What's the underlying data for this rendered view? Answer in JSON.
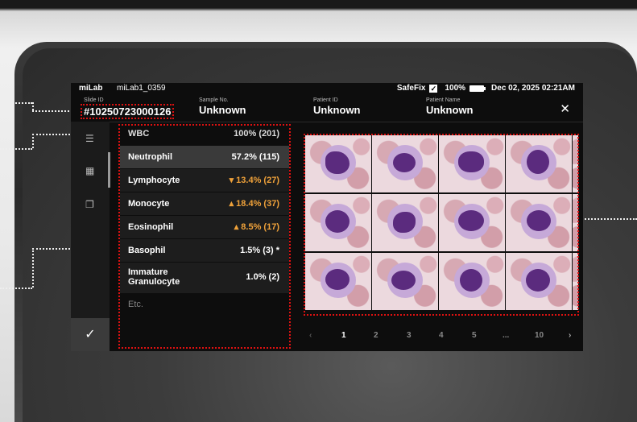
{
  "status_bar": {
    "brand": "miLab",
    "device": "miLab1_0359",
    "safefix": "SafeFix",
    "battery": "100%",
    "datetime": "Dec 02, 2025 02:21AM"
  },
  "header": {
    "slide_id_label": "Slide ID",
    "slide_id": "#10250723000126",
    "sample_label": "Sample No.",
    "sample": "Unknown",
    "patient_id_label": "Patient ID",
    "patient_id": "Unknown",
    "patient_name_label": "Patient Name",
    "patient_name": "Unknown"
  },
  "wbc": {
    "label": "WBC",
    "value": "100% (201)"
  },
  "cells": [
    {
      "name": "Neutrophil",
      "value": "57.2% (115)",
      "trend": "",
      "selected": true
    },
    {
      "name": "Lymphocyte",
      "value": "▾ 13.4% (27)",
      "trend": "down"
    },
    {
      "name": "Monocyte",
      "value": "▴ 18.4% (37)",
      "trend": "up"
    },
    {
      "name": "Eosinophil",
      "value": "▴ 8.5% (17)",
      "trend": "up"
    },
    {
      "name": "Basophil",
      "value": "1.5% (3) *",
      "trend": ""
    },
    {
      "name": "Immature\nGranulocyte",
      "value": "1.0% (2)",
      "trend": ""
    }
  ],
  "etc_label": "Etc.",
  "pagination": {
    "pages": [
      "1",
      "2",
      "3",
      "4",
      "5",
      "...",
      "10"
    ],
    "current": "1"
  },
  "icons": [
    "checklist-icon",
    "grid-icon",
    "layers-icon",
    "check-icon",
    "close-icon",
    "chevron-left-icon",
    "chevron-right-icon"
  ],
  "colors": {
    "accent": "#f0a23a",
    "highlight": "#d11"
  }
}
